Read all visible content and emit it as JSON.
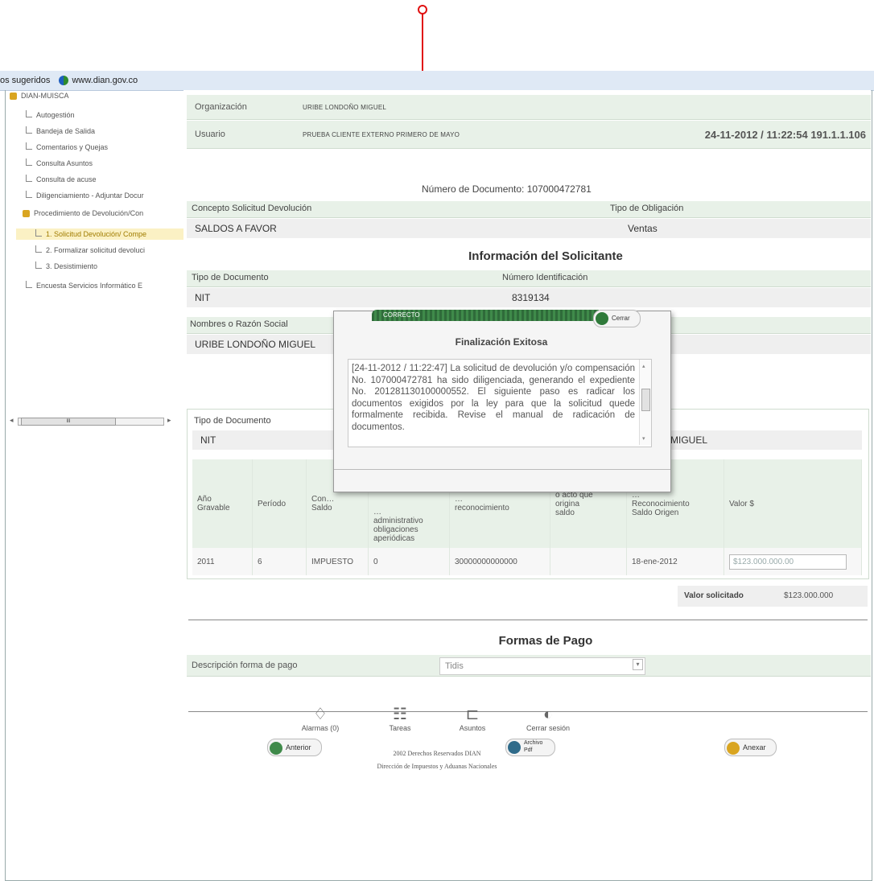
{
  "browser": {
    "favorites_label": "os sugeridos",
    "favorite_link": "www.dian.gov.co"
  },
  "sidebar": {
    "root": "DIAN-MUISCA",
    "items": [
      {
        "label": "Autogestión"
      },
      {
        "label": "Bandeja de Salida"
      },
      {
        "label": "Comentarios y Quejas"
      },
      {
        "label": "Consulta Asuntos"
      },
      {
        "label": "Consulta de acuse"
      },
      {
        "label": "Diligenciamiento - Adjuntar Docur"
      },
      {
        "label": "Procedimiento de Devolución/Con"
      },
      {
        "label": "1. Solicitud Devolución/ Compe"
      },
      {
        "label": "2. Formalizar solicitud devoluci"
      },
      {
        "label": "3. Desistimiento"
      },
      {
        "label": "Encuesta Servicios Informático E"
      }
    ],
    "scroll_thumb": "III"
  },
  "header": {
    "org_label": "Organización",
    "org_value": "URIBE LONDOÑO MIGUEL",
    "user_label": "Usuario",
    "user_value": "PRUEBA CLIENTE EXTERNO PRIMERO DE MAYO",
    "session_info": "24-11-2012 / 11:22:54 191.1.1.106"
  },
  "document": {
    "number_label": "Número de Documento: 107000472781",
    "concepto_label": "Concepto Solicitud Devolución",
    "concepto_value": "SALDOS A FAVOR",
    "tipo_obligacion_label": "Tipo de Obligación",
    "tipo_obligacion_value": "Ventas"
  },
  "solicitante": {
    "title": "Información del Solicitante",
    "tipo_doc_label": "Tipo de Documento",
    "tipo_doc_value": "NIT",
    "num_id_label": "Número Identificación",
    "num_id_value": "8319134",
    "nombres_label": "Nombres o Razón Social",
    "nombres_value": "URIBE LONDOÑO MIGUEL"
  },
  "second_block": {
    "tipo_doc_label": "Tipo de Documento",
    "tipo_doc_value": "NIT",
    "name_partial": "MIGUEL"
  },
  "table": {
    "headers": [
      "Año Gravable",
      "Período",
      "Concepto Saldo",
      "Acto administrativo obligaciones aperiódicas",
      "Fecha documento reconocimiento",
      "o acto que origina saldo",
      "Documento Reconocimiento Saldo Origen",
      "Valor $"
    ],
    "header_display": [
      "Año\nGravable",
      "Período",
      "Con...\nSaldo",
      "...\nadministrativo\nobligaciones\naperiódicas",
      "...\nreconocimiento",
      "o acto que\norigina\nsaldo",
      "...\nReconocimiento\nSaldo Origen",
      "Valor $"
    ],
    "rows": [
      [
        "2011",
        "6",
        "IMPUESTO",
        "0",
        "30000000000000",
        "",
        "18-ene-2012",
        "$123.000.000.00"
      ]
    ]
  },
  "valor_solicitado": {
    "label": "Valor solicitado",
    "value": "$123.000.000"
  },
  "pago": {
    "title": "Formas de Pago",
    "desc_label": "Descripción forma de pago",
    "select_value": "Tidis"
  },
  "buttons": {
    "anterior": "Anterior",
    "archivo": "Archivo Pdf",
    "anexar": "Anexar"
  },
  "footer": {
    "alarmas": "Alarmas (0)",
    "tareas": "Tareas",
    "asuntos": "Asuntos",
    "cerrar": "Cerrar sesión",
    "copyright": "2002 Derechos Reservados DIAN",
    "entity": "Dirección de Impuestos y Aduanas Nacionales"
  },
  "modal": {
    "bar_label": "CORRECTO",
    "close_label": "Cerrar",
    "title": "Finalización Exitosa",
    "message": "[24-11-2012 / 11:22:47] La solicitud de devolución y/o compensación No. 107000472781 ha sido diligenciada, generando el expediente No. 201281130100000552. El siguiente paso es radicar los documentos exigidos por la ley para que la solicitud quede formalmente recibida. Revise el manual de radicación de documentos."
  },
  "colors": {
    "annotation": "#e01010",
    "header_green": "#e8f1e8",
    "modal_bar": "#3f8a4a"
  }
}
